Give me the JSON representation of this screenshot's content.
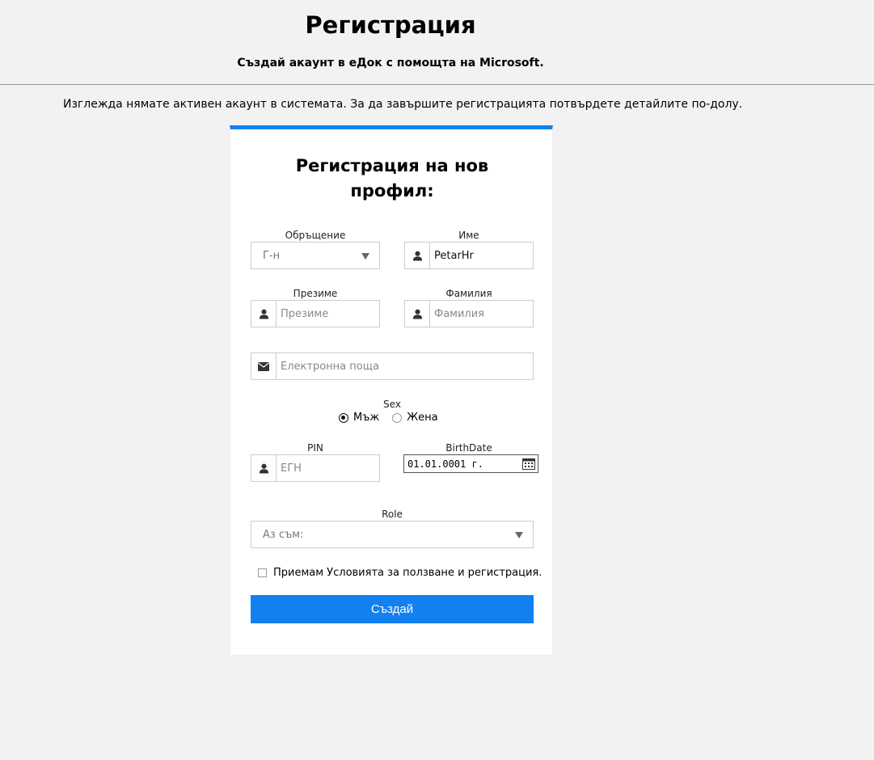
{
  "header": {
    "title": "Регистрация",
    "subtitle": "Създай акаунт в eДок с помощта на Microsoft."
  },
  "info": "Изглежда нямате активен акаунт в системата. За да завършите регистрацията потвърдете детайлите по-долу.",
  "form": {
    "title_line1": "Регистрация на нов",
    "title_line2": "профил:",
    "salutation": {
      "label": "Обръщение",
      "value": "Г-н"
    },
    "first_name": {
      "label": "Име",
      "value": "PetarHr",
      "icon": "user-icon"
    },
    "middle_name": {
      "label": "Презиме",
      "placeholder": "Презиме",
      "icon": "user-icon"
    },
    "last_name": {
      "label": "Фамилия",
      "placeholder": "Фамилия",
      "icon": "user-icon"
    },
    "email": {
      "placeholder": "Електронна поща",
      "icon": "envelope-icon"
    },
    "sex": {
      "label": "Sex",
      "options": [
        {
          "label": "Мъж",
          "checked": true
        },
        {
          "label": "Жена",
          "checked": false
        }
      ]
    },
    "pin": {
      "label": "PIN",
      "placeholder": "ЕГН",
      "icon": "user-icon"
    },
    "birthdate": {
      "label": "BirthDate",
      "value": "01.01.0001 г.",
      "icon": "calendar-icon"
    },
    "role": {
      "label": "Role",
      "placeholder": "Аз съм:"
    },
    "terms": {
      "label": "Приемам Условията за ползване и регистрация.",
      "checked": false
    },
    "submit_label": "Създай"
  },
  "colors": {
    "accent": "#1380f0",
    "background": "#f2f2f2"
  }
}
